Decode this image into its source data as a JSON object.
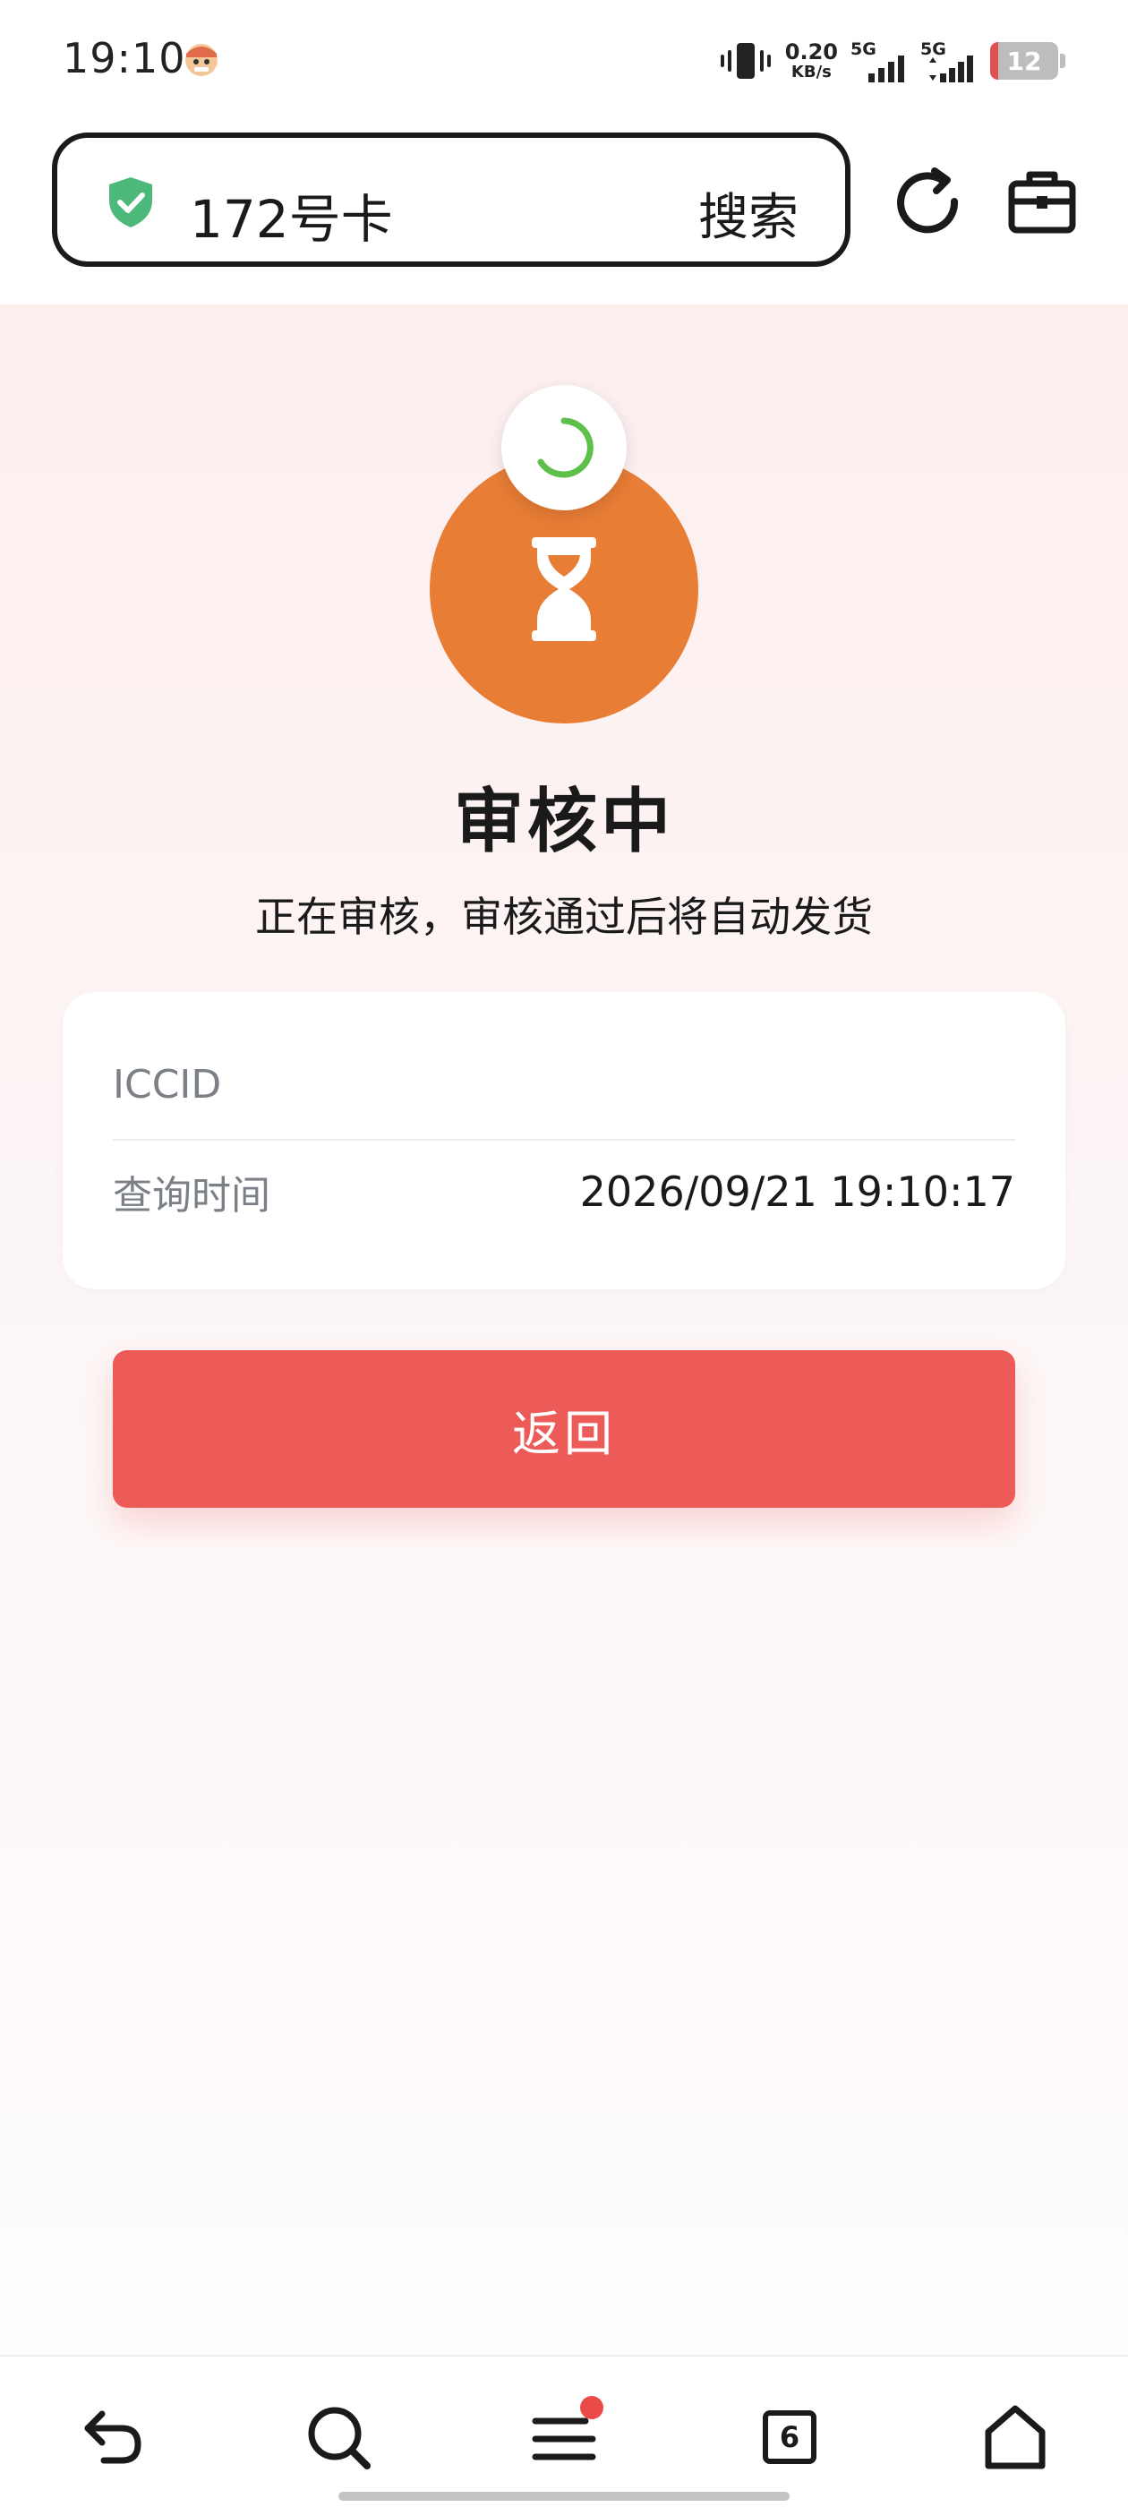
{
  "status_bar": {
    "time": "19:10",
    "net_speed_value": "0.20",
    "net_speed_unit": "KB/s",
    "sim1_label": "5G",
    "sim2_label": "5G",
    "battery_level": "12",
    "battery_fraction": 0.12,
    "icons": [
      "avatar-icon",
      "vibrate-icon",
      "signal-icon",
      "battery-icon"
    ]
  },
  "browser": {
    "address_text": "172号卡",
    "search_label": "搜索",
    "icons": [
      "shield-check-icon",
      "refresh-icon",
      "toolbox-icon"
    ]
  },
  "review": {
    "title": "审核中",
    "subtitle": "正在审核，审核通过后将自动发货",
    "icons": [
      "hourglass-icon",
      "loading-spinner-icon"
    ]
  },
  "info": {
    "rows": [
      {
        "label": "ICCID",
        "value": ""
      },
      {
        "label": "查询时间",
        "value": "2026/09/21 19:10:17"
      }
    ]
  },
  "actions": {
    "back_label": "返回"
  },
  "bottom_nav": {
    "tab_count": "6",
    "icons": [
      "back-arrow-icon",
      "search-icon",
      "menu-icon",
      "tabs-icon",
      "home-icon"
    ]
  },
  "colors": {
    "accent_orange": "#e87d36",
    "button_red": "#ec5b58",
    "spinner_green": "#5cc04a",
    "shield_green": "#4cb87a",
    "notification_red": "#ea4b47"
  }
}
